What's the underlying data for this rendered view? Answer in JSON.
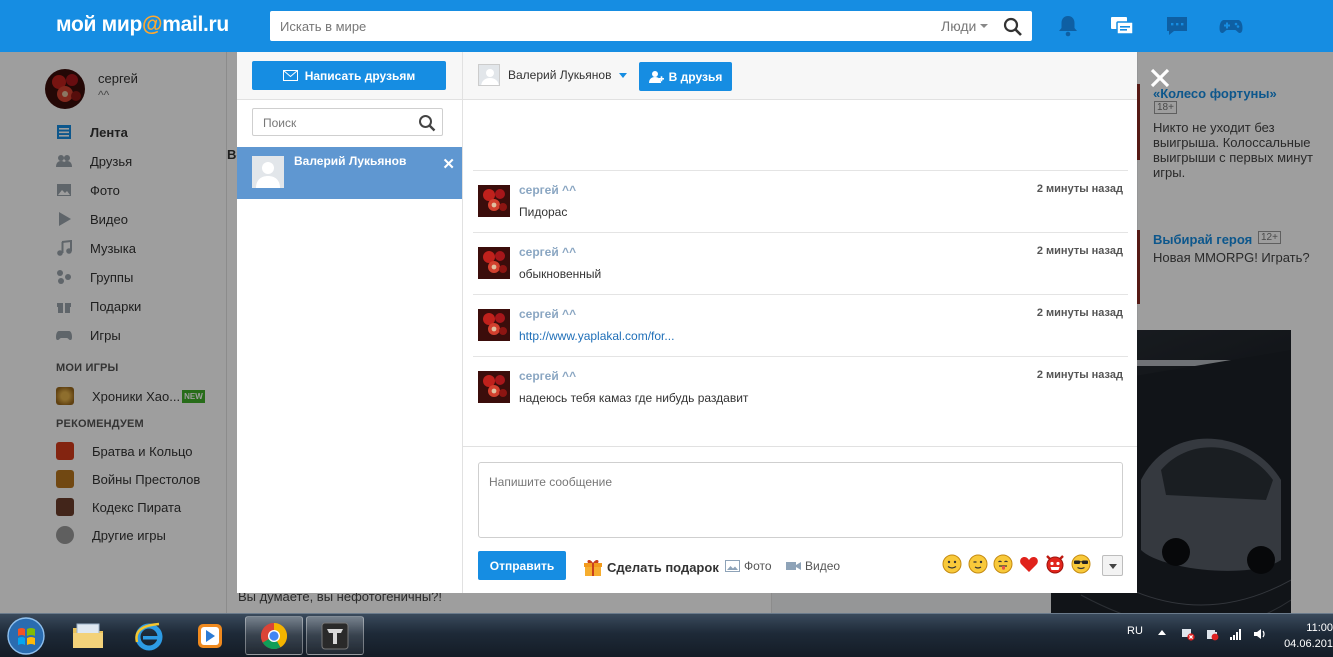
{
  "topbar": {
    "logo_left": "мой мир",
    "logo_at": "@",
    "logo_right": "mail.ru",
    "search_placeholder": "Искать в мире",
    "search_scope": "Люди",
    "icons": [
      "search-icon",
      "bell-icon",
      "chat-icon",
      "messages-icon",
      "gamepad-icon"
    ],
    "brand_color": "#168de2"
  },
  "profile": {
    "name": "сергей",
    "status": "^^"
  },
  "nav": [
    {
      "label": "Лента",
      "icon": "feed-icon",
      "active": true
    },
    {
      "label": "Друзья",
      "icon": "friends-icon"
    },
    {
      "label": "Фото",
      "icon": "photo-icon"
    },
    {
      "label": "Видео",
      "icon": "video-icon"
    },
    {
      "label": "Музыка",
      "icon": "music-icon"
    },
    {
      "label": "Группы",
      "icon": "groups-icon"
    },
    {
      "label": "Подарки",
      "icon": "gifts-icon"
    },
    {
      "label": "Игры",
      "icon": "games-icon"
    }
  ],
  "my_games": {
    "title": "МОИ ИГРЫ",
    "items": [
      {
        "label": "Хроники Хао...",
        "badge": "NEW"
      }
    ]
  },
  "recommended": {
    "title": "РЕКОМЕНДУЕМ",
    "items": [
      {
        "label": "Братва и Кольцо",
        "color": "#d33a1a"
      },
      {
        "label": "Войны Престолов",
        "color": "#b6741d"
      },
      {
        "label": "Кодекс Пирата",
        "color": "#6b3d2a"
      },
      {
        "label": "Другие игры",
        "color": "#9a9a9a"
      }
    ]
  },
  "background_feed": {
    "cut_heading": "Во",
    "footer_text": "Вы думаете, вы нефотогеничны?!"
  },
  "ads": [
    {
      "title": "«Колесо фортуны»",
      "age": "18+",
      "text": "Никто не уходит без выигрыша. Колоссальные выигрыши с первых минут игры."
    },
    {
      "title": "Выбирай героя",
      "age": "12+",
      "text": "Новая MMORPG! Играть?"
    }
  ],
  "chat": {
    "write_friends_label": "Написать друзьям",
    "search_placeholder": "Поиск",
    "contact_name": "Валерий Лукьянов",
    "peer_name": "Валерий Лукьянов",
    "add_friend_label": "В друзья",
    "messages": [
      {
        "author": "сергей ^^",
        "time": "2 минуты назад",
        "text": "Пидорас",
        "is_link": false
      },
      {
        "author": "сергей ^^",
        "time": "2 минуты назад",
        "text": "обыкновенный",
        "is_link": false
      },
      {
        "author": "сергей ^^",
        "time": "2 минуты назад",
        "text": "http://www.yaplakal.com/for...",
        "is_link": true
      },
      {
        "author": "сергей ^^",
        "time": "2 минуты назад",
        "text": "надеюсь тебя камаз где нибудь раздавит",
        "is_link": false
      }
    ],
    "composer_placeholder": "Напишите сообщение",
    "send_label": "Отправить",
    "gift_label": "Сделать подарок",
    "photo_label": "Фото",
    "video_label": "Видео",
    "emojis": [
      "smile-emoji",
      "wink-emoji",
      "tongue-emoji",
      "heart-emoji",
      "devil-emoji",
      "sunglasses-emoji"
    ]
  },
  "taskbar": {
    "apps": [
      "explorer-icon",
      "ie-icon",
      "media-player-icon",
      "chrome-icon",
      "world-of-tanks-icon"
    ],
    "language": "RU",
    "time": "11:00",
    "date": "04.06.201"
  }
}
